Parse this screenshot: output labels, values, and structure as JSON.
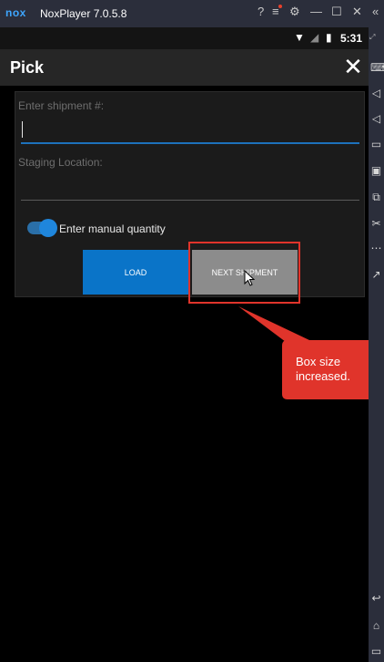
{
  "emulator": {
    "logo": "nox",
    "title": "NoxPlayer 7.0.5.8",
    "controls": [
      "?",
      "≡",
      "⚙",
      "—",
      "☐",
      "✕",
      "«"
    ]
  },
  "statusbar": {
    "time": "5:31"
  },
  "app": {
    "title": "Pick",
    "close_glyph": "✕"
  },
  "form": {
    "shipment_label": "Enter shipment #:",
    "shipment_value": "",
    "staging_label": "Staging Location:",
    "staging_value": "",
    "manual_qty_label": "Enter manual quantity",
    "manual_qty_on": true,
    "load_label": "LOAD",
    "next_label": "NEXT SHIPMENT"
  },
  "annotation": {
    "callout_line1": "Box size",
    "callout_line2": "increased.",
    "color": "#e0342b"
  },
  "colors": {
    "accent": "#0a74c8",
    "toggle": "#1f86dc",
    "next_button": "#8c8c8c"
  }
}
